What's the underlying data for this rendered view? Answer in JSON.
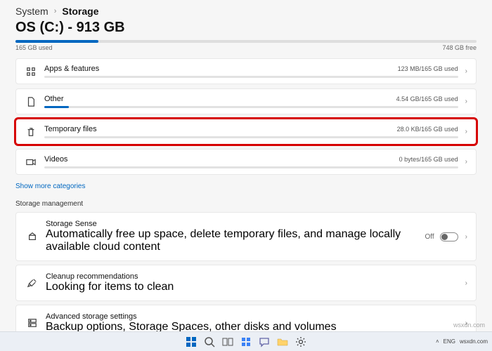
{
  "breadcrumb": {
    "parent": "System",
    "current": "Storage"
  },
  "drive": {
    "title": "OS (C:) - 913 GB",
    "used_label": "165 GB used",
    "free_label": "748 GB free",
    "fill_percent": 18
  },
  "categories": [
    {
      "label": "Apps & features",
      "used": "123 MB/165 GB used",
      "fill": 0,
      "icon": "apps"
    },
    {
      "label": "Other",
      "used": "4.54 GB/165 GB used",
      "fill": 6,
      "icon": "doc"
    },
    {
      "label": "Temporary files",
      "used": "28.0 KB/165 GB used",
      "fill": 0,
      "icon": "trash",
      "highlight": true
    },
    {
      "label": "Videos",
      "used": "0 bytes/165 GB used",
      "fill": 0,
      "icon": "video"
    }
  ],
  "show_more": "Show more categories",
  "section_mgmt": "Storage management",
  "mgmt": [
    {
      "label": "Storage Sense",
      "sub": "Automatically free up space, delete temporary files, and manage locally available cloud content",
      "state_label": "Off",
      "toggle": true,
      "icon": "sense"
    },
    {
      "label": "Cleanup recommendations",
      "sub": "Looking for items to clean",
      "icon": "broom"
    },
    {
      "label": "Advanced storage settings",
      "sub": "Backup options, Storage Spaces, other disks and volumes",
      "icon": "advanced"
    }
  ],
  "tray": {
    "lang": "ENG",
    "text": "wsxdn.com"
  },
  "watermark": "wsxdn.com"
}
